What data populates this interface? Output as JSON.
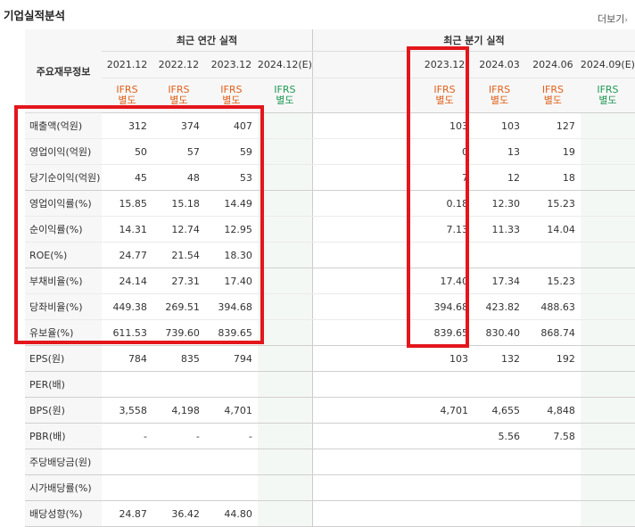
{
  "section": {
    "title": "기업실적분석",
    "more_label": "더보기"
  },
  "table": {
    "corner_label": "주요재무정보",
    "annual_group_label": "최근 연간 실적",
    "quarter_group_label": "최근 분기 실적",
    "annual_periods": [
      "2021.12",
      "2022.12",
      "2023.12",
      "2024.12(E)"
    ],
    "quarter_periods": [
      "2023.12",
      "2024.03",
      "2024.06",
      "2024.09(E)"
    ],
    "basis_line1": "IFRS",
    "basis_line2": "별도",
    "rows": [
      {
        "label": "매출액(억원)",
        "annual": [
          "312",
          "374",
          "407",
          ""
        ],
        "quarter": [
          "103",
          "103",
          "127",
          ""
        ]
      },
      {
        "label": "영업이익(억원)",
        "annual": [
          "50",
          "57",
          "59",
          ""
        ],
        "quarter": [
          "0",
          "13",
          "19",
          ""
        ]
      },
      {
        "label": "당기순이익(억원)",
        "annual": [
          "45",
          "48",
          "53",
          ""
        ],
        "quarter": [
          "7",
          "12",
          "18",
          ""
        ]
      },
      {
        "label": "영업이익률(%)",
        "annual": [
          "15.85",
          "15.18",
          "14.49",
          ""
        ],
        "quarter": [
          "0.18",
          "12.30",
          "15.23",
          ""
        ]
      },
      {
        "label": "순이익률(%)",
        "annual": [
          "14.31",
          "12.74",
          "12.95",
          ""
        ],
        "quarter": [
          "7.13",
          "11.33",
          "14.04",
          ""
        ]
      },
      {
        "label": "ROE(%)",
        "annual": [
          "24.77",
          "21.54",
          "18.30",
          ""
        ],
        "quarter": [
          "",
          "",
          "",
          ""
        ]
      },
      {
        "label": "부채비율(%)",
        "annual": [
          "24.14",
          "27.31",
          "17.40",
          ""
        ],
        "quarter": [
          "17.40",
          "17.34",
          "15.23",
          ""
        ]
      },
      {
        "label": "당좌비율(%)",
        "annual": [
          "449.38",
          "269.51",
          "394.68",
          ""
        ],
        "quarter": [
          "394.68",
          "423.82",
          "488.63",
          ""
        ]
      },
      {
        "label": "유보율(%)",
        "annual": [
          "611.53",
          "739.60",
          "839.65",
          ""
        ],
        "quarter": [
          "839.65",
          "830.40",
          "868.74",
          ""
        ]
      },
      {
        "label": "EPS(원)",
        "annual": [
          "784",
          "835",
          "794",
          ""
        ],
        "quarter": [
          "103",
          "132",
          "192",
          ""
        ]
      },
      {
        "label": "PER(배)",
        "annual": [
          "",
          "",
          "",
          ""
        ],
        "quarter": [
          "",
          "",
          "",
          ""
        ]
      },
      {
        "label": "BPS(원)",
        "annual": [
          "3,558",
          "4,198",
          "4,701",
          ""
        ],
        "quarter": [
          "4,701",
          "4,655",
          "4,848",
          ""
        ]
      },
      {
        "label": "PBR(배)",
        "annual": [
          "-",
          "-",
          "-",
          ""
        ],
        "quarter": [
          "",
          "5.56",
          "7.58",
          ""
        ]
      },
      {
        "label": "주당배당금(원)",
        "annual": [
          "",
          "",
          "",
          ""
        ],
        "quarter": [
          "",
          "",
          "",
          ""
        ]
      },
      {
        "label": "시가배당률(%)",
        "annual": [
          "",
          "",
          "",
          ""
        ],
        "quarter": [
          "",
          "",
          "",
          ""
        ]
      },
      {
        "label": "배당성향(%)",
        "annual": [
          "24.87",
          "36.42",
          "44.80",
          ""
        ],
        "quarter": [
          "",
          "",
          "",
          ""
        ]
      }
    ]
  },
  "highlight_color": "#e3161c"
}
